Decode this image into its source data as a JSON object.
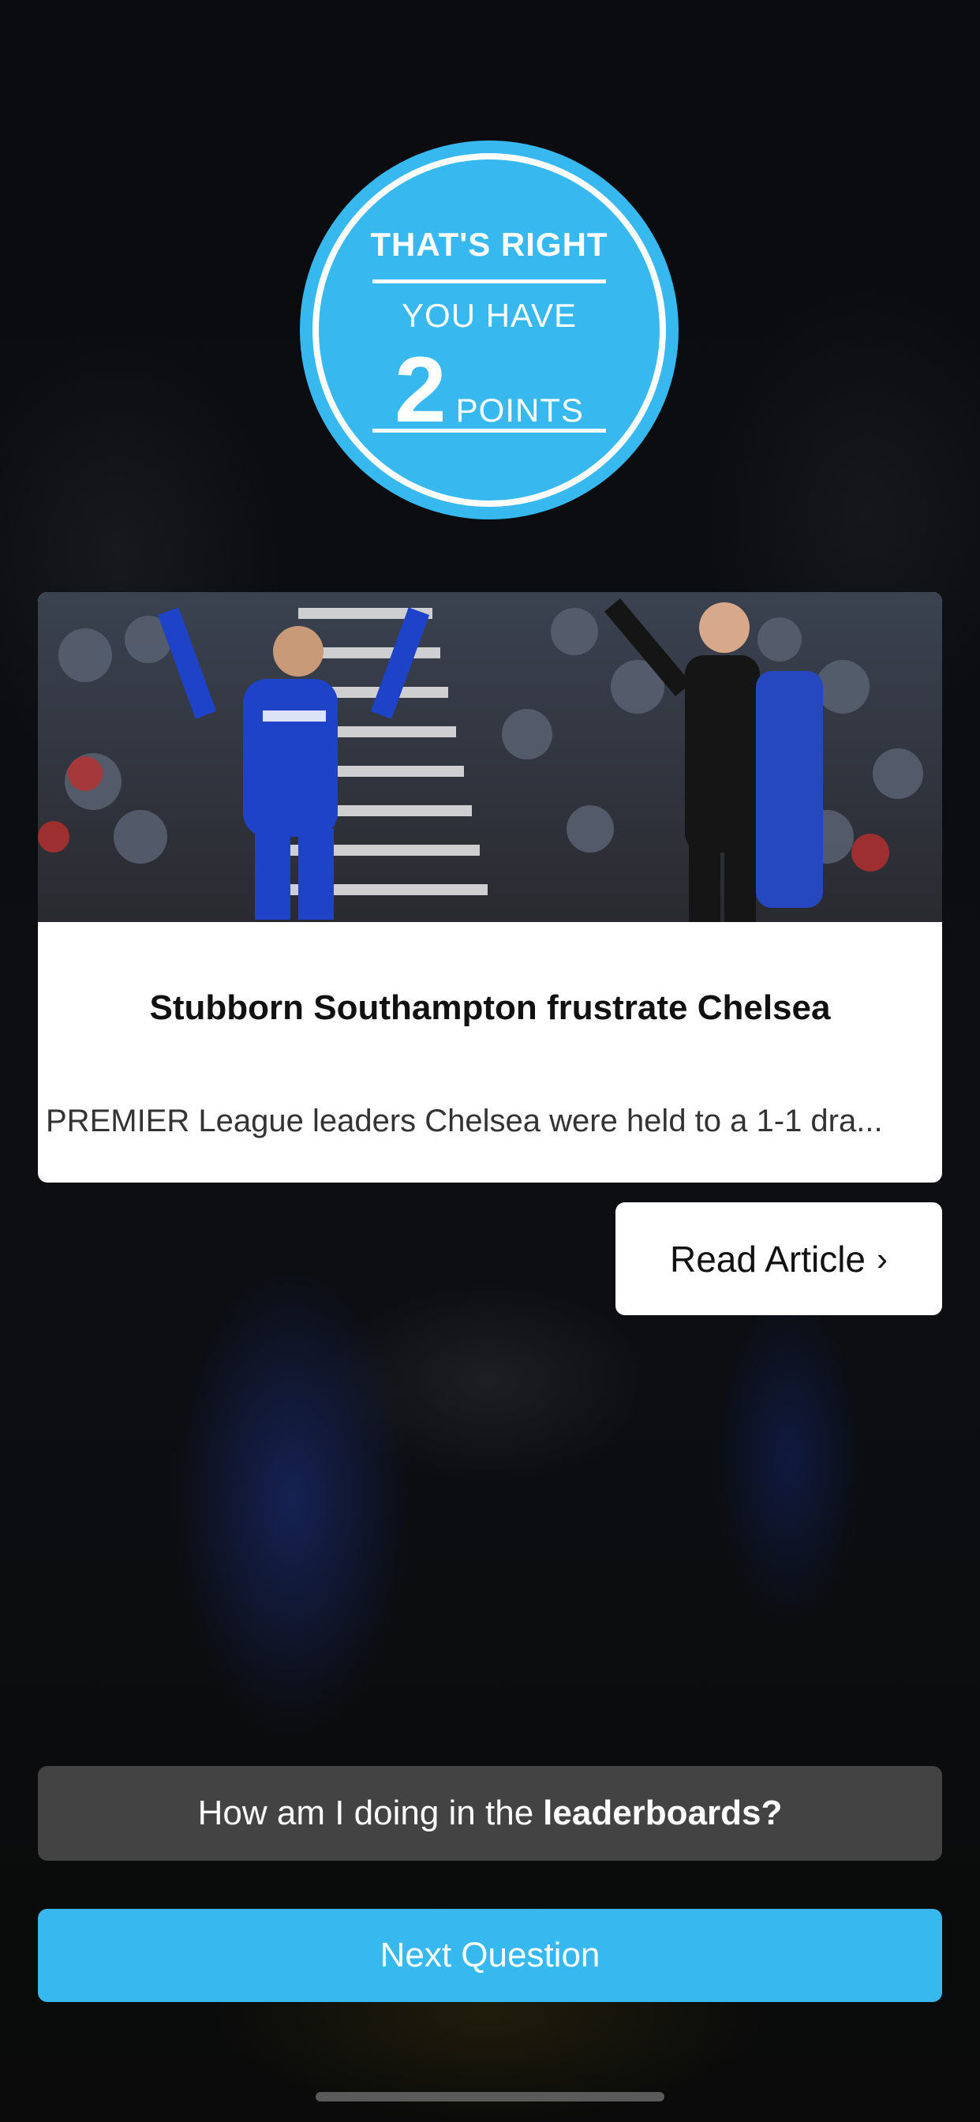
{
  "badge": {
    "title": "THAT'S RIGHT",
    "subtitle": "YOU HAVE",
    "points": "2",
    "unit": "POINTS"
  },
  "article": {
    "image_description_icon": "football-photo",
    "title": "Stubborn Southampton frustrate Chelsea",
    "excerpt": "PREMIER League leaders Chelsea were held to a 1-1 dra...",
    "read_label": "Read Article",
    "read_chevron": "›"
  },
  "leaderboard": {
    "prefix": "How am I doing in the",
    "emphasis": "leaderboards?"
  },
  "next": {
    "label": "Next Question"
  },
  "colors": {
    "accent": "#37b8ee",
    "leaderboard_button": "#434343",
    "background": "#07090d"
  }
}
